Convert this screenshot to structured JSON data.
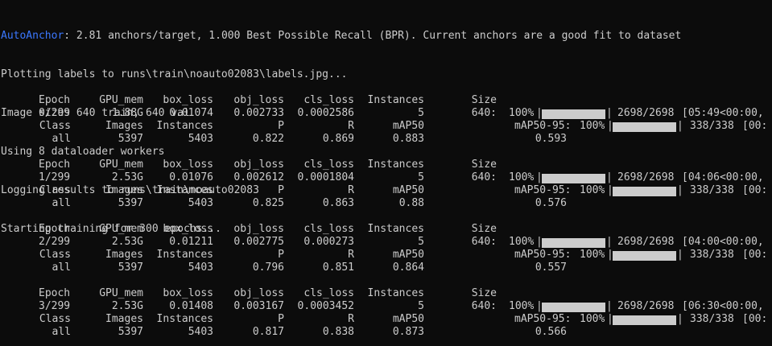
{
  "log_lines": [
    {
      "prefix": "AutoAnchor",
      "text": ": 2.81 anchors/target, 1.000 Best Possible Recall (BPR). Current anchors are a good fit to dataset"
    },
    {
      "prefix": "",
      "text": "Plotting labels to runs\\train\\noauto02083\\labels.jpg..."
    },
    {
      "prefix": "",
      "text": "Image sizes 640 train, 640 val"
    },
    {
      "prefix": "",
      "text": "Using 8 dataloader workers"
    },
    {
      "prefix": "",
      "text": "Logging results to runs\\train\\noauto02083"
    },
    {
      "prefix": "",
      "text": "Starting training for 300 epochs..."
    }
  ],
  "accent_color": "#3b78ff",
  "train_header": [
    "Epoch",
    "GPU_mem",
    "box_loss",
    "obj_loss",
    "cls_loss",
    "Instances",
    "Size"
  ],
  "val_header": [
    "Class",
    "Images",
    "Instances",
    "P",
    "R",
    "mAP50",
    "mAP50-95:"
  ],
  "epochs": [
    {
      "epoch": "0/299",
      "gpu_mem": "1.88G",
      "box_loss": "0.01074",
      "obj_loss": "0.002733",
      "cls_loss": "0.0002586",
      "instances": "5",
      "size": "640:",
      "train_pct": "100%",
      "train_count": "2698/2698",
      "train_time": "[05:49<00:00,",
      "val_pct": "100%",
      "val_count": "338/338",
      "val_time": "[00:",
      "class": "all",
      "images": "5397",
      "val_instances": "5403",
      "p": "0.822",
      "r": "0.869",
      "map50": "0.883",
      "map50_95": "0.593",
      "train_progress": 1.0,
      "val_progress": 1.0
    },
    {
      "epoch": "1/299",
      "gpu_mem": "2.53G",
      "box_loss": "0.01076",
      "obj_loss": "0.002612",
      "cls_loss": "0.0001804",
      "instances": "5",
      "size": "640:",
      "train_pct": "100%",
      "train_count": "2698/2698",
      "train_time": "[04:06<00:00,",
      "val_pct": "100%",
      "val_count": "338/338",
      "val_time": "[00:",
      "class": "all",
      "images": "5397",
      "val_instances": "5403",
      "p": "0.825",
      "r": "0.863",
      "map50": "0.88",
      "map50_95": "0.576",
      "train_progress": 1.0,
      "val_progress": 1.0
    },
    {
      "epoch": "2/299",
      "gpu_mem": "2.53G",
      "box_loss": "0.01211",
      "obj_loss": "0.002775",
      "cls_loss": "0.000273",
      "instances": "5",
      "size": "640:",
      "train_pct": "100%",
      "train_count": "2698/2698",
      "train_time": "[04:00<00:00,",
      "val_pct": "100%",
      "val_count": "338/338",
      "val_time": "[00:",
      "class": "all",
      "images": "5397",
      "val_instances": "5403",
      "p": "0.796",
      "r": "0.851",
      "map50": "0.864",
      "map50_95": "0.557",
      "train_progress": 1.0,
      "val_progress": 1.0
    },
    {
      "epoch": "3/299",
      "gpu_mem": "2.53G",
      "box_loss": "0.01408",
      "obj_loss": "0.003167",
      "cls_loss": "0.0003452",
      "instances": "5",
      "size": "640:",
      "train_pct": "100%",
      "train_count": "2698/2698",
      "train_time": "[06:30<00:00,",
      "val_pct": "100%",
      "val_count": "338/338",
      "val_time": "[00:",
      "class": "all",
      "images": "5397",
      "val_instances": "5403",
      "p": "0.817",
      "r": "0.838",
      "map50": "0.873",
      "map50_95": "0.566",
      "train_progress": 1.0,
      "val_progress": 1.0
    }
  ]
}
